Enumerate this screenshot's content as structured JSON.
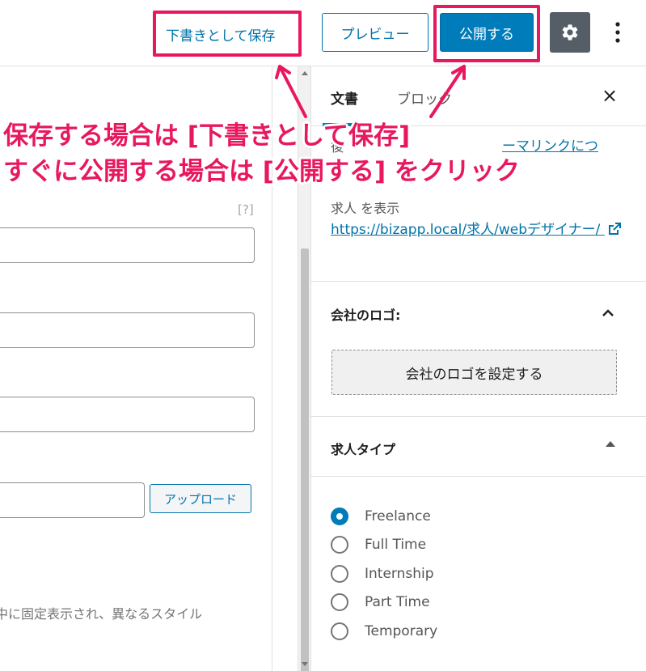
{
  "toolbar": {
    "save_draft_label": "下書きとして保存",
    "preview_label": "プレビュー",
    "publish_label": "公開する"
  },
  "editor": {
    "help_mark": "[?]",
    "upload_label": "アップロード",
    "description_fragment": "中に固定表示され、異なるスタイル"
  },
  "sidebar": {
    "tabs": [
      {
        "label": "文書",
        "active": true
      },
      {
        "label": "ブロック",
        "active": false
      }
    ],
    "close_label": "×",
    "permalink": {
      "partial_text_left": "後",
      "partial_link_right": "ーマリンクにつ",
      "view_label": "求人 を表示",
      "url": "https://bizapp.local/求人/webデザイナー/"
    },
    "logo_panel": {
      "title": "会社のロゴ:",
      "button_label": "会社のロゴを設定する"
    },
    "job_type_panel": {
      "title": "求人タイプ",
      "options": [
        {
          "label": "Freelance",
          "checked": true
        },
        {
          "label": "Full Time",
          "checked": false
        },
        {
          "label": "Internship",
          "checked": false
        },
        {
          "label": "Part Time",
          "checked": false
        },
        {
          "label": "Temporary",
          "checked": false
        }
      ]
    }
  },
  "annotation": {
    "line1": "保存する場合は [下書きとして保存]",
    "line2": "すぐに公開する場合は [公開する] をクリック",
    "color": "#e8185f"
  },
  "colors": {
    "accent": "#007cba",
    "link": "#0073aa",
    "settings_bg": "#555d66"
  }
}
